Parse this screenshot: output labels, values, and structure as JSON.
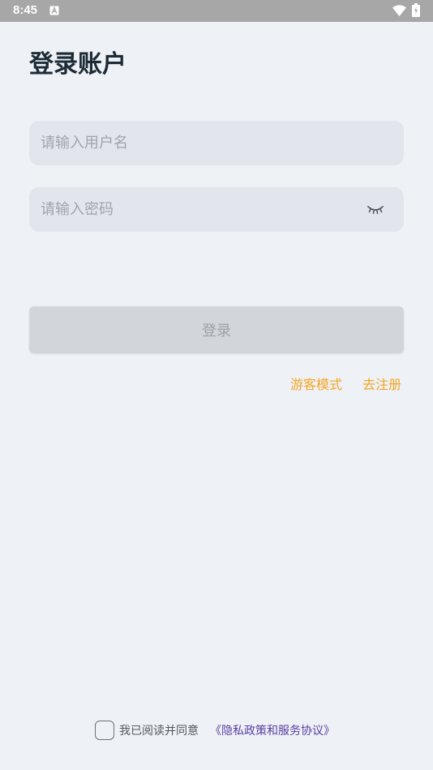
{
  "status_bar": {
    "time": "8:45",
    "notification_icon": "a-notification-icon",
    "wifi_icon": "wifi-icon",
    "battery_icon": "battery-charging-icon"
  },
  "page_title": "登录账户",
  "username_field": {
    "placeholder": "请输入用户名",
    "value": ""
  },
  "password_field": {
    "placeholder": "请输入密码",
    "value": "",
    "toggle_icon": "eye-closed-icon"
  },
  "login_button": {
    "label": "登录"
  },
  "links": {
    "guest": "游客模式",
    "register": "去注册"
  },
  "agreement": {
    "text": "我已阅读并同意",
    "policy": "《隐私政策和服务协议》",
    "checked": false
  },
  "colors": {
    "background": "#eef1f6",
    "status_bar": "#a7a7a7",
    "field_bg": "#e2e5ec",
    "button_disabled": "#d2d5da",
    "link_accent": "#f5a623",
    "policy_link": "#5a3ea3"
  }
}
